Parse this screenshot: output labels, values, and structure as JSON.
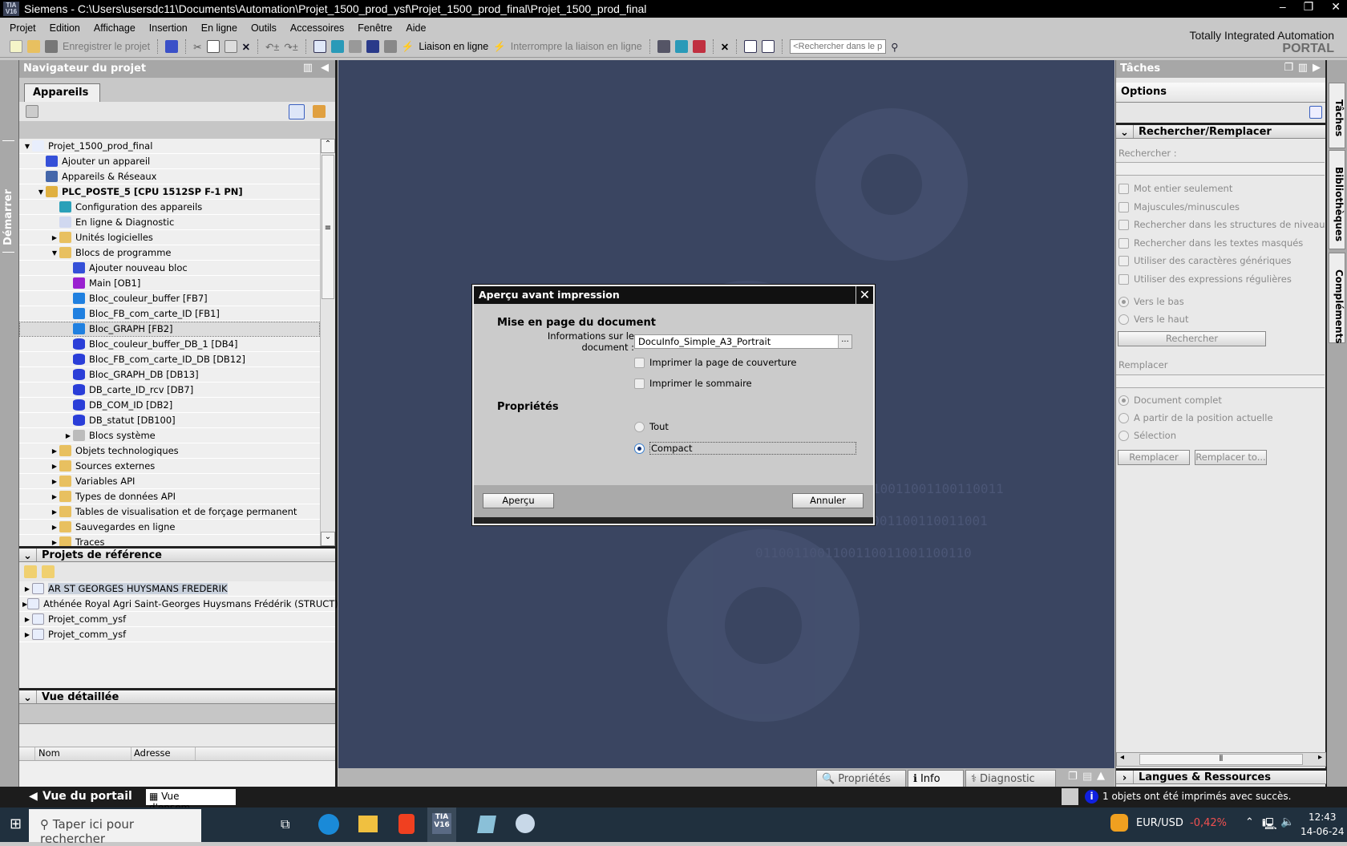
{
  "window": {
    "title": "Siemens  -  C:\\Users\\usersdc11\\Documents\\Automation\\Projet_1500_prod_ysf\\Projet_1500_prod_final\\Projet_1500_prod_final",
    "logo": "TIA V16",
    "controls": [
      "–",
      "❐",
      "✕"
    ]
  },
  "menu": [
    "Projet",
    "Edition",
    "Affichage",
    "Insertion",
    "En ligne",
    "Outils",
    "Accessoires",
    "Fenêtre",
    "Aide"
  ],
  "toolbar": {
    "save_label": "Enregistrer le projet",
    "go_online": "Liaison en ligne",
    "go_offline": "Interrompre la liaison en ligne",
    "search_placeholder": "<Rechercher dans le projet>"
  },
  "brand": {
    "line1": "Totally Integrated Automation",
    "line2": "PORTAL"
  },
  "start_strip": "Démarrer",
  "navigator": {
    "title": "Navigateur du projet",
    "tab": "Appareils",
    "tree": [
      {
        "label": "Projet_1500_prod_final",
        "level": 0,
        "exp": "open",
        "icon": "project",
        "color": "#e8eefc"
      },
      {
        "label": "Ajouter un appareil",
        "level": 1,
        "exp": "",
        "icon": "add-device",
        "color": "#3550d8"
      },
      {
        "label": "Appareils & Réseaux",
        "level": 1,
        "exp": "",
        "icon": "network",
        "color": "#4466aa"
      },
      {
        "label": "PLC_POSTE_5 [CPU 1512SP F-1 PN]",
        "level": 1,
        "exp": "open",
        "icon": "plc",
        "color": "#e0b040",
        "bold": true
      },
      {
        "label": "Configuration des appareils",
        "level": 2,
        "exp": "",
        "icon": "device-config",
        "color": "#2aa0b8"
      },
      {
        "label": "En ligne & Diagnostic",
        "level": 2,
        "exp": "",
        "icon": "diagnostic",
        "color": "#d0d8f0"
      },
      {
        "label": "Unités logicielles",
        "level": 2,
        "exp": "closed",
        "icon": "folder",
        "color": "#e8c060"
      },
      {
        "label": "Blocs de programme",
        "level": 2,
        "exp": "open",
        "icon": "folder",
        "color": "#e8c060"
      },
      {
        "label": "Ajouter nouveau bloc",
        "level": 3,
        "exp": "",
        "icon": "add-block",
        "color": "#3550d8"
      },
      {
        "label": "Main [OB1]",
        "level": 3,
        "exp": "",
        "icon": "ob-block",
        "color": "#9a20d0"
      },
      {
        "label": "Bloc_couleur_buffer [FB7]",
        "level": 3,
        "exp": "",
        "icon": "fb-block",
        "color": "#2080e0"
      },
      {
        "label": "Bloc_FB_com_carte_ID [FB1]",
        "level": 3,
        "exp": "",
        "icon": "fb-block",
        "color": "#2080e0"
      },
      {
        "label": "Bloc_GRAPH [FB2]",
        "level": 3,
        "exp": "",
        "icon": "fb-block",
        "color": "#2080e0",
        "selected": true
      },
      {
        "label": "Bloc_couleur_buffer_DB_1 [DB4]",
        "level": 3,
        "exp": "",
        "icon": "db-block",
        "color": "#2a3ed8"
      },
      {
        "label": "Bloc_FB_com_carte_ID_DB [DB12]",
        "level": 3,
        "exp": "",
        "icon": "db-block",
        "color": "#2a3ed8"
      },
      {
        "label": "Bloc_GRAPH_DB [DB13]",
        "level": 3,
        "exp": "",
        "icon": "db-block",
        "color": "#2a3ed8"
      },
      {
        "label": "DB_carte_ID_rcv [DB7]",
        "level": 3,
        "exp": "",
        "icon": "db-block",
        "color": "#2a3ed8"
      },
      {
        "label": "DB_COM_ID [DB2]",
        "level": 3,
        "exp": "",
        "icon": "db-block",
        "color": "#2a3ed8"
      },
      {
        "label": "DB_statut [DB100]",
        "level": 3,
        "exp": "",
        "icon": "db-block",
        "color": "#2a3ed8"
      },
      {
        "label": "Blocs système",
        "level": 3,
        "exp": "closed",
        "icon": "folder",
        "color": "#bbbbbb"
      },
      {
        "label": "Objets technologiques",
        "level": 2,
        "exp": "closed",
        "icon": "folder",
        "color": "#e8c060"
      },
      {
        "label": "Sources externes",
        "level": 2,
        "exp": "closed",
        "icon": "folder",
        "color": "#e8c060"
      },
      {
        "label": "Variables API",
        "level": 2,
        "exp": "closed",
        "icon": "folder",
        "color": "#e8c060"
      },
      {
        "label": "Types de données API",
        "level": 2,
        "exp": "closed",
        "icon": "folder",
        "color": "#e8c060"
      },
      {
        "label": "Tables de visualisation et de forçage permanent",
        "level": 2,
        "exp": "closed",
        "icon": "folder",
        "color": "#e8c060"
      },
      {
        "label": "Sauvegardes en ligne",
        "level": 2,
        "exp": "closed",
        "icon": "folder",
        "color": "#e8c060"
      },
      {
        "label": "Traces",
        "level": 2,
        "exp": "closed",
        "icon": "folder",
        "color": "#e8c060"
      }
    ]
  },
  "reference": {
    "title": "Projets de référence",
    "items": [
      "AR ST GEORGES HUYSMANS FREDERIK",
      "Athénée Royal Agri Saint-Georges Huysmans Frédérik (STRUCT)",
      "Projet_comm_ysf",
      "Projet_comm_ysf"
    ]
  },
  "detail": {
    "title": "Vue détaillée",
    "columns": [
      "Nom",
      "Adresse"
    ]
  },
  "dialog": {
    "title": "Aperçu avant  impression",
    "section1": "Mise en page du document",
    "doc_info_label": "Informations sur le document :",
    "doc_info_value": "DocuInfo_Simple_A3_Portrait",
    "browse": "...",
    "cover": "Imprimer la page de couverture",
    "toc": "Imprimer le sommaire",
    "section2": "Propriétés",
    "all": "Tout",
    "compact": "Compact",
    "preview_btn": "Aperçu",
    "cancel_btn": "Annuler"
  },
  "bottom_tabs": [
    "Propriétés",
    "Info",
    "Diagnostic"
  ],
  "tasks": {
    "title": "Tâches",
    "options": "Options",
    "section": "Rechercher/Remplacer",
    "search_label": "Rechercher :",
    "checks": [
      "Mot entier seulement",
      "Majuscules/minuscules",
      "Rechercher dans les structures de niveau inférieur",
      "Rechercher dans les textes masqués",
      "Utiliser des caractères génériques",
      "Utiliser des expressions régulières"
    ],
    "dir": [
      "Vers le bas",
      "Vers le haut"
    ],
    "search_btn": "Rechercher",
    "replace_label": "Remplacer",
    "scope": [
      "Document complet",
      "A partir de la position actuelle",
      "Sélection"
    ],
    "replace_btn": "Remplacer",
    "replace_all_btn": "Remplacer to...",
    "languages": "Langues & Ressources"
  },
  "right_tabs": [
    "Tâches",
    "Bibliothèques",
    "Compléments"
  ],
  "portal": {
    "portal_view": "Vue du portail",
    "overview": "Vue d'ensem...",
    "status": "1 objets ont été imprimés avec succès."
  },
  "taskbar": {
    "search": "Taper ici pour rechercher",
    "ticker": "EUR/USD",
    "change": "-0,42%",
    "time": "12:43",
    "date": "14-06-24"
  }
}
